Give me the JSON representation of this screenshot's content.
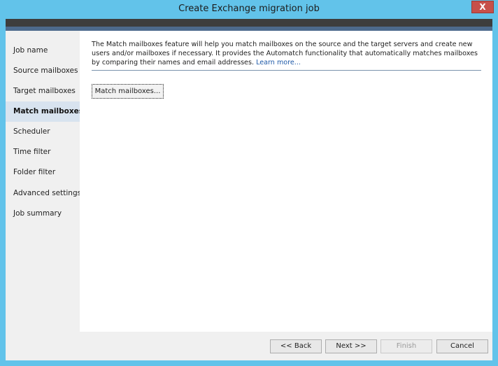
{
  "window": {
    "title": "Create Exchange migration job",
    "close_label": "X"
  },
  "sidebar": {
    "items": [
      {
        "label": "Job name",
        "active": false
      },
      {
        "label": "Source mailboxes",
        "active": false
      },
      {
        "label": "Target mailboxes",
        "active": false
      },
      {
        "label": "Match mailboxes",
        "active": true
      },
      {
        "label": "Scheduler",
        "active": false
      },
      {
        "label": "Time filter",
        "active": false
      },
      {
        "label": "Folder filter",
        "active": false
      },
      {
        "label": "Advanced settings",
        "active": false
      },
      {
        "label": "Job summary",
        "active": false
      }
    ]
  },
  "main": {
    "description": "The Match mailboxes feature will help you match mailboxes on the source and the target servers and create new users and/or mailboxes if necessary. It provides the Automatch functionality that automatically matches mailboxes by comparing their names and email addresses.",
    "learn_more": "Learn more...",
    "match_button": "Match mailboxes..."
  },
  "footer": {
    "back": "<< Back",
    "next": "Next >>",
    "finish": "Finish",
    "cancel": "Cancel"
  },
  "colors": {
    "frame": "#62c3ea",
    "close": "#c7504a",
    "active_item": "#d8e3ef",
    "link": "#1e5aa8"
  }
}
